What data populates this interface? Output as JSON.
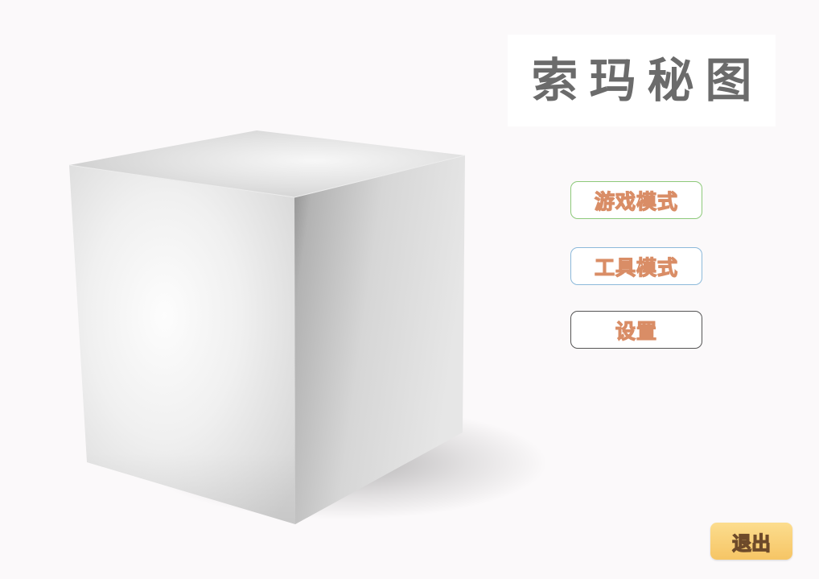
{
  "title": "索玛秘图",
  "menu": {
    "game_mode": "游戏模式",
    "tool_mode": "工具模式",
    "settings": "设置"
  },
  "exit": "退出",
  "colors": {
    "background": "#fbf9fa",
    "title_text": "#6b6b6b",
    "label_outline": "#d98d66",
    "game_mode_border": "#8dc97a",
    "tool_mode_border": "#8cb9da",
    "settings_border": "#555555",
    "exit_background": "#f6c565"
  }
}
